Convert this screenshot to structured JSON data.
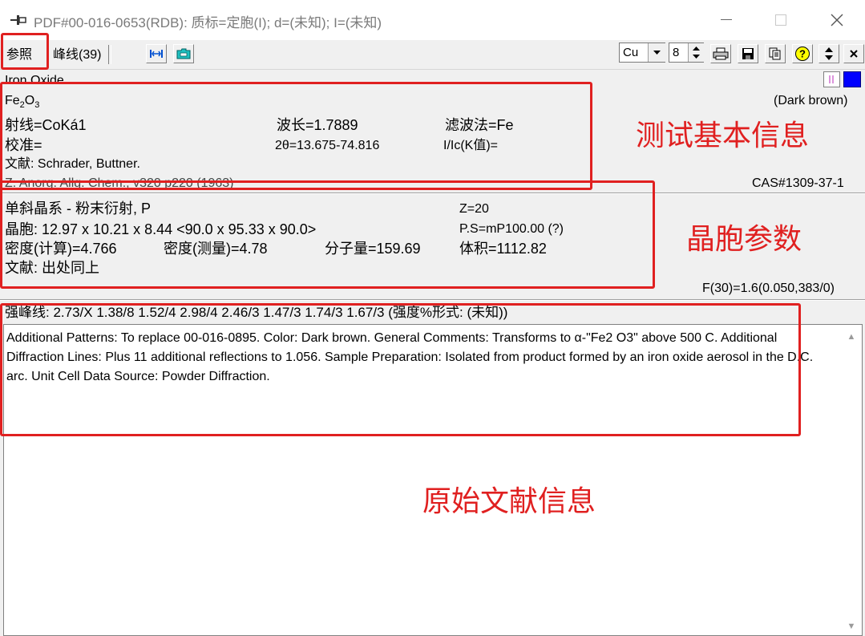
{
  "window": {
    "title": "PDF#00-016-0653(RDB): 质标=定胞(I); d=(未知); I=(未知)"
  },
  "tabs": [
    {
      "label": "参照"
    },
    {
      "label": "峰线(39)"
    }
  ],
  "toolbar": {
    "radiation_value": "Cu",
    "digits_value": "8"
  },
  "header": {
    "name": "Iron Oxide",
    "formula_base": "Fe",
    "formula_sub1": "2",
    "formula_mid": "O",
    "formula_sub2": "3",
    "color": "(Dark brown)"
  },
  "experiment": {
    "radiation": "射线=CoKá1",
    "wavelength": "波长=1.7889",
    "filter": "滤波法=Fe",
    "calibration": "校准=",
    "two_theta": "2θ=13.675-74.816",
    "i_ic": "I/Ic(K值)=",
    "reference": "文献: Schrader, Buttner.",
    "journal": "Z. Anorg. Allg. Chem., v320 p220 (1963)",
    "cas": "CAS#1309-37-1"
  },
  "cell": {
    "system": "单斜晶系 - 粉末衍射, P",
    "z": "Z=20",
    "params": "晶胞: 12.97 x 10.21 x 8.44 <90.0 x 95.33 x 90.0>",
    "pearson": "P.S=mP100.00 (?)",
    "density_calc": "密度(计算)=4.766",
    "density_meas": "密度(测量)=4.78",
    "mol_weight": "分子量=159.69",
    "volume": "体积=1112.82",
    "reference": "文献: 出处同上",
    "fom": "F(30)=1.6(0.050,383/0)"
  },
  "strong_lines": "强峰线: 2.73/X 1.38/8 1.52/4 2.98/4 2.46/3 1.47/3 1.74/3 1.67/3 (强度%形式: (未知))",
  "comments": "Additional Patterns: To replace 00-016-0895. Color: Dark brown. General Comments: Transforms to α-\"Fe2 O3\" above 500 C. Additional Diffraction Lines: Plus 11 additional reflections to 1.056. Sample Preparation: Isolated from product formed by an iron oxide aerosol in the D.C. arc. Unit Cell Data Source: Powder Diffraction.",
  "annotations": {
    "test_info": "测试基本信息",
    "cell_params": "晶胞参数",
    "original_ref": "原始文献信息"
  },
  "colors": {
    "annotation_red": "#e02020",
    "swatch_blue": "#0000ff",
    "swatch_pink": "#d070d0"
  }
}
